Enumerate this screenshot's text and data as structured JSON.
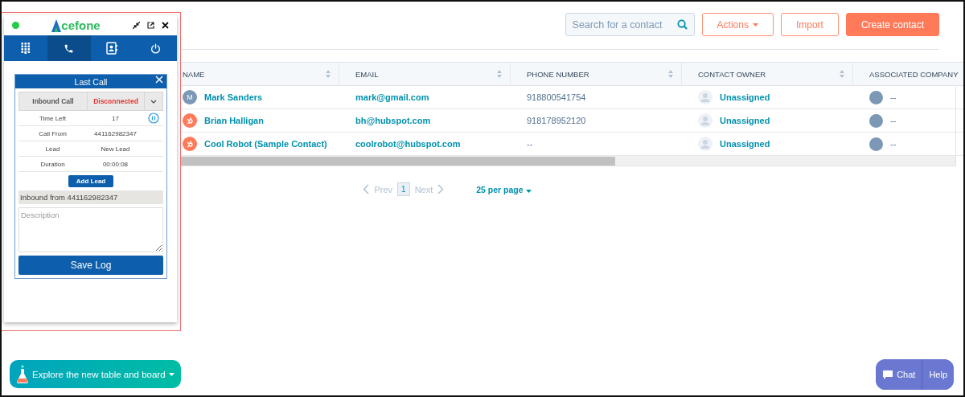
{
  "contacts": {
    "search": {
      "placeholder": "Search for a contact"
    },
    "actions": [
      {
        "label": "Actions",
        "kind": "menu"
      },
      {
        "label": "Import",
        "kind": "outline"
      },
      {
        "label": "Create contact",
        "kind": "primary"
      }
    ],
    "table": {
      "columns": [
        "NAME",
        "EMAIL",
        "PHONE NUMBER",
        "CONTACT OWNER",
        "ASSOCIATED COMPANY"
      ],
      "rows": [
        {
          "avatar": {
            "kind": "initial",
            "text": "M"
          },
          "name": "Mark Sanders",
          "email": "mark@gmail.com",
          "phone": "918800541754",
          "owner": "Unassigned",
          "company": "--"
        },
        {
          "avatar": {
            "kind": "hubspot"
          },
          "name": "Brian Halligan",
          "email": "bh@hubspot.com",
          "phone": "918178952120",
          "owner": "Unassigned",
          "company": "--"
        },
        {
          "avatar": {
            "kind": "hubspot"
          },
          "name": "Cool Robot (Sample Contact)",
          "email": "coolrobot@hubspot.com",
          "phone": "--",
          "owner": "Unassigned",
          "company": "--"
        }
      ]
    },
    "pagination": {
      "prev": "Prev",
      "page": "1",
      "next": "Next",
      "per_page": "25 per page"
    }
  },
  "widget": {
    "logo": "cefone",
    "tabs": [
      {
        "kind": "dialpad",
        "selected": false
      },
      {
        "kind": "phone",
        "selected": true
      },
      {
        "kind": "contacts",
        "selected": false
      },
      {
        "kind": "power",
        "selected": false
      }
    ],
    "last_call": {
      "title": "Last Call",
      "call_type": "Inbound Call",
      "status": "Disconnected",
      "details": [
        {
          "label": "Time Left",
          "value": "17",
          "kind": "timer"
        },
        {
          "label": "Call From",
          "value": "441162982347",
          "kind": "plain"
        },
        {
          "label": "Lead",
          "value": "New Lead",
          "kind": "plain"
        },
        {
          "label": "Duration",
          "value": "00:00:08",
          "kind": "plain"
        }
      ],
      "add_lead": "Add Lead",
      "summary": "Inbound from 441162982347",
      "description": {
        "placeholder": "Description"
      },
      "save": "Save Log"
    }
  },
  "explore": "Explore the new table and board",
  "chat": {
    "chat": "Chat",
    "help": "Help"
  }
}
